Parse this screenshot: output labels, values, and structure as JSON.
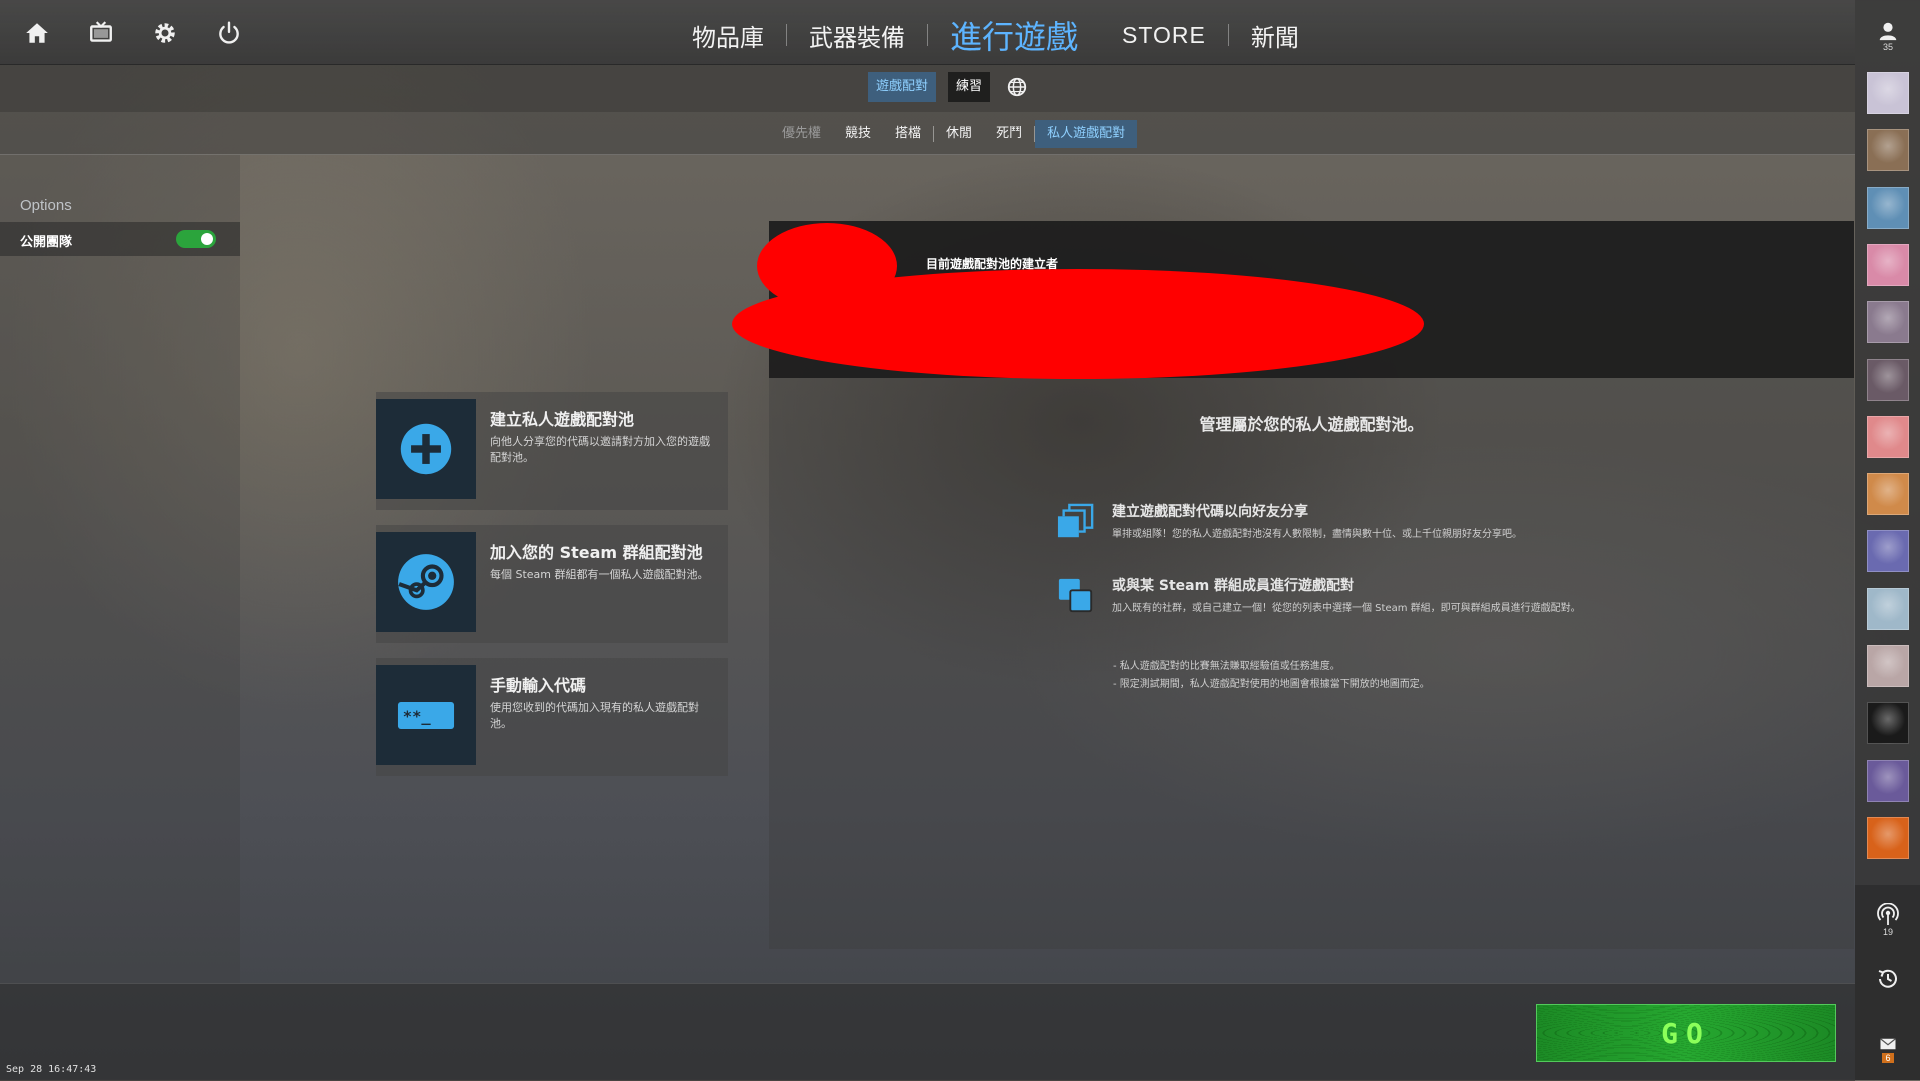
{
  "top_icons": [
    "home-icon",
    "tv-icon",
    "gear-icon",
    "power-icon"
  ],
  "main_nav": {
    "inventory": "物品庫",
    "loadout": "武器裝備",
    "play": "進行遊戲",
    "store": "STORE",
    "news": "新聞"
  },
  "mode_tabs": {
    "matchmaking": "遊戲配對",
    "practice": "練習"
  },
  "type_tabs": {
    "premier": "優先權",
    "competitive": "競技",
    "wingman": "搭檔",
    "casual": "休閒",
    "deathmatch": "死鬥",
    "private": "私人遊戲配對"
  },
  "sidebar": {
    "options_title": "Options",
    "public_team_label": "公開團隊",
    "public_team_enabled": true
  },
  "cards": [
    {
      "title": "建立私人遊戲配對池",
      "desc": "向他人分享您的代碼以邀請對方加入您的遊戲配對池。",
      "icon": "plus-circle-icon"
    },
    {
      "title": "加入您的 Steam 群組配對池",
      "desc": "每個 Steam 群組都有一個私人遊戲配對池。",
      "icon": "steam-icon"
    },
    {
      "title": "手動輸入代碼",
      "desc": "使用您收到的代碼加入現有的私人遊戲配對池。",
      "icon": "code-input-icon"
    }
  ],
  "panel": {
    "creator_label": "目前遊戲配對池的建立者",
    "manage_title": "管理屬於您的私人遊戲配對池。",
    "features": [
      {
        "title": "建立遊戲配對代碼以向好友分享",
        "desc": "單排或組隊！您的私人遊戲配對池沒有人數限制，盡情與數十位、或上千位親朋好友分享吧。"
      },
      {
        "title": "或與某 Steam 群組成員進行遊戲配對",
        "desc": "加入既有的社群，或自己建立一個！從您的列表中選擇一個 Steam 群組，即可與群組成員進行遊戲配對。"
      }
    ],
    "notes": [
      "- 私人遊戲配對的比賽無法賺取經驗值或任務進度。",
      "- 限定測試期間，私人遊戲配對使用的地圖會根據當下開放的地圖而定。"
    ]
  },
  "go_label": "GO",
  "timestamp": "Sep 28 16:47:43",
  "friends": {
    "profile_count": "35",
    "broadcast_count": "19",
    "mail_count": "6",
    "avatar_colors": [
      "#c9c3d6",
      "#8a6f55",
      "#5f8fb5",
      "#d98aa8",
      "#8a7a8e",
      "#6a5a66",
      "#e0898b",
      "#d08a4a",
      "#6a6ab0",
      "#9fb8c9",
      "#b9a6a6",
      "#1a1a1a",
      "#6a5a9a",
      "#d8621a"
    ]
  },
  "colors": {
    "accent": "#5db4ff",
    "active_tab_bg": "#3e5f7d",
    "go_green": "#26a830",
    "redaction": "#ff0000"
  }
}
